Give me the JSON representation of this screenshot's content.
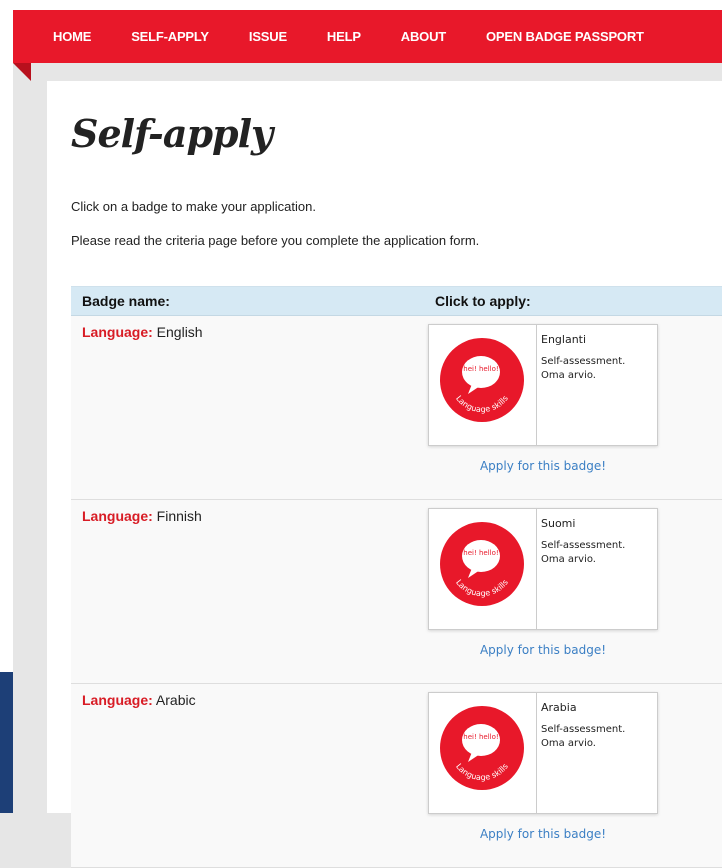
{
  "nav": {
    "items": [
      "HOME",
      "SELF-APPLY",
      "ISSUE",
      "HELP",
      "ABOUT",
      "OPEN BADGE PASSPORT"
    ]
  },
  "page": {
    "title": "Self-apply",
    "intro_1": "Click on a badge to make your application.",
    "intro_2": "Please read the criteria page before you complete the application form."
  },
  "table": {
    "header_name": "Badge name:",
    "header_apply": "Click to apply:"
  },
  "badges": [
    {
      "prefix": "Language:",
      "name": "English",
      "card_title": "Englanti",
      "card_desc": "Self-assessment. Oma arvio.",
      "apply_label": "Apply for this badge!"
    },
    {
      "prefix": "Language:",
      "name": "Finnish",
      "card_title": "Suomi",
      "card_desc": "Self-assessment. Oma arvio.",
      "apply_label": "Apply for this badge!"
    },
    {
      "prefix": "Language:",
      "name": "Arabic",
      "card_title": "Arabia",
      "card_desc": "Self-assessment. Oma arvio.",
      "apply_label": "Apply for this badge!"
    }
  ],
  "badge_image": {
    "bubble_text": "hei! hello!",
    "ring_text": "Language skills"
  },
  "colors": {
    "nav_bg": "#e8182a",
    "header_bg": "#d6e9f4",
    "label_red": "#d81c25",
    "link_blue": "#3b7fc4"
  }
}
